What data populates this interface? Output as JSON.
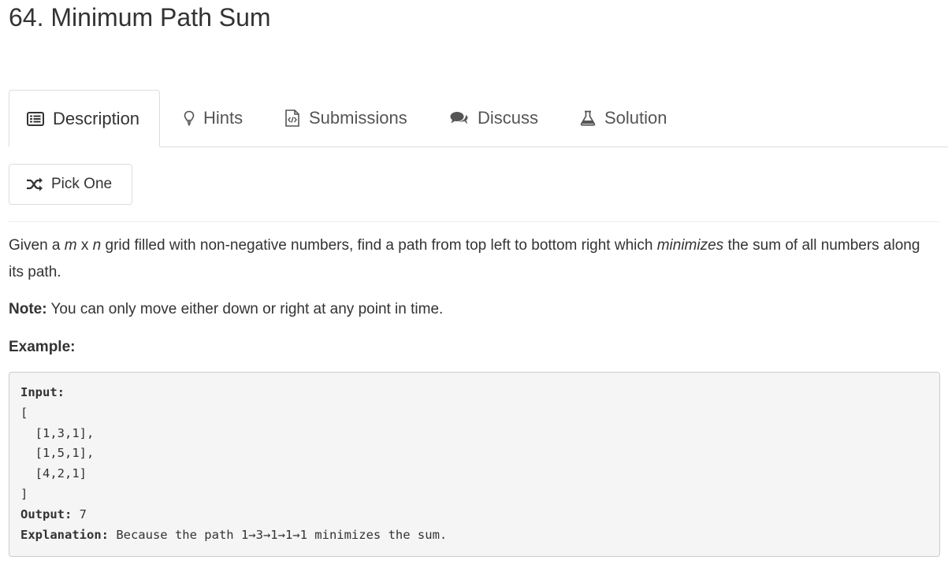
{
  "problem": {
    "title": "64. Minimum Path Sum"
  },
  "tabs": [
    {
      "label": "Description",
      "icon": "list-icon"
    },
    {
      "label": "Hints",
      "icon": "lightbulb-icon"
    },
    {
      "label": "Submissions",
      "icon": "code-file-icon"
    },
    {
      "label": "Discuss",
      "icon": "comments-icon"
    },
    {
      "label": "Solution",
      "icon": "flask-icon"
    }
  ],
  "pick_one": {
    "label": "Pick One",
    "icon": "shuffle-icon"
  },
  "description": {
    "p1_a": "Given a ",
    "p1_m": "m",
    "p1_x": " x ",
    "p1_n": "n",
    "p1_b": " grid filled with non-negative numbers, find a path from top left to bottom right which ",
    "p1_min": "minimizes",
    "p1_c": " the sum of all numbers along its path.",
    "note_label": "Note:",
    "note_text": " You can only move either down or right at any point in time.",
    "example_label": "Example:"
  },
  "example": {
    "input_label": "Input:",
    "lines": [
      "[",
      "  [1,3,1],",
      "  [1,5,1],",
      "  [4,2,1]",
      "]"
    ],
    "output_label": "Output:",
    "output_value": " 7",
    "explanation_label": "Explanation:",
    "explanation_text": " Because the path 1→3→1→1→1 minimizes the sum."
  }
}
